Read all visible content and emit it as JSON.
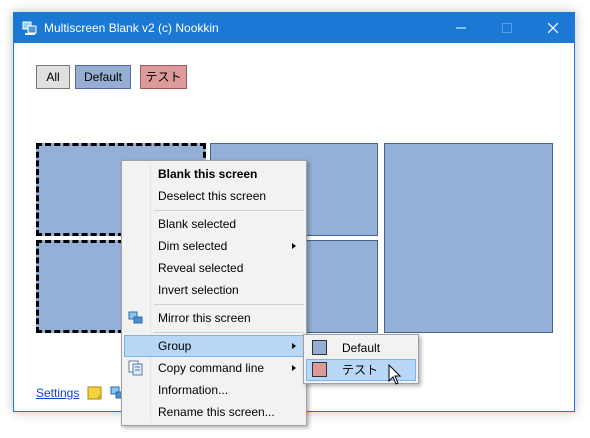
{
  "window": {
    "title": "Multiscreen Blank v2 (c) Nookkin"
  },
  "groups": {
    "all": "All",
    "default": "Default",
    "test": "テスト"
  },
  "footer": {
    "settings_label": "Settings"
  },
  "context_menu": {
    "items": [
      {
        "label": "Blank this screen",
        "bold": true
      },
      {
        "label": "Deselect this screen"
      },
      {
        "label": "Blank selected"
      },
      {
        "label": "Dim selected",
        "submenu": true
      },
      {
        "label": "Reveal selected"
      },
      {
        "label": "Invert selection"
      },
      {
        "label": "Mirror this screen",
        "icon": "monitors-icon"
      },
      {
        "label": "Group",
        "submenu": true,
        "highlighted": true
      },
      {
        "label": "Copy command line",
        "icon": "copy-icon",
        "submenu": true
      },
      {
        "label": "Information..."
      },
      {
        "label": "Rename this screen..."
      }
    ]
  },
  "group_submenu": {
    "items": [
      {
        "label": "Default",
        "color": "#96aed4"
      },
      {
        "label": "テスト",
        "color": "#dd9a9a",
        "highlighted": true
      }
    ]
  },
  "colors": {
    "titlebar": "#1b78d4",
    "screen_fill": "#94b0d8",
    "default_group": "#96aed4",
    "test_group": "#dd9a9a",
    "menu_highlight": "#b8d6f6"
  }
}
